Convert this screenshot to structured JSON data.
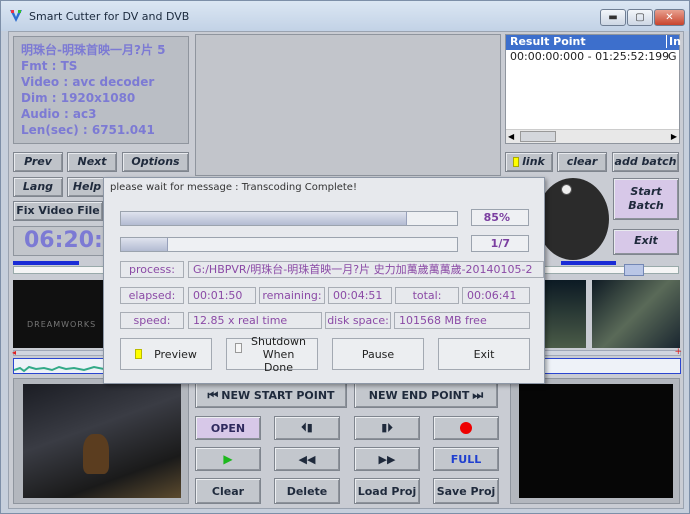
{
  "window": {
    "title": "Smart Cutter for DV and DVB",
    "min_label": "▬",
    "max_label": "▢",
    "close_label": "✕"
  },
  "info": {
    "line1": "明珠台-明珠首映一月?片 5",
    "fmt": "Fmt : TS",
    "video": "Video : avc decoder",
    "dim": "Dim : 1920x1080",
    "audio": "Audio : ac3",
    "len": "Len(sec) : 6751.041"
  },
  "nav": {
    "prev": "Prev",
    "next": "Next",
    "options": "Options",
    "lang": "Lang",
    "help": "Help",
    "fix_video": "Fix Video File"
  },
  "timecode": "06:20:3",
  "result": {
    "col1": "Result Point",
    "col2": "In",
    "row1_col1": "00:00:00:000 - 01:25:52:199",
    "row1_col2": "G"
  },
  "batch": {
    "link": "link",
    "clear": "clear",
    "add_batch": "add batch",
    "start_batch": "Start Batch",
    "exit": "Exit"
  },
  "controls": {
    "new_start": "NEW START POINT",
    "new_end": "NEW END POINT",
    "open": "OPEN",
    "full": "FULL",
    "clear": "Clear",
    "delete": "Delete",
    "load_proj": "Load Proj",
    "save_proj": "Save Proj"
  },
  "dialog": {
    "title": "please wait for message : Transcoding Complete!",
    "progress1_label": "85%",
    "progress1_value": 0.85,
    "progress2_label": "1/7",
    "progress2_value": 0.14,
    "process_label": "process:",
    "process_value": "G:/HBPVR/明珠台-明珠首映一月?片 史力加萬歲萬萬歲-20140105-2",
    "elapsed_label": "elapsed:",
    "elapsed_value": "00:01:50",
    "remaining_label": "remaining:",
    "remaining_value": "00:04:51",
    "total_label": "total:",
    "total_value": "00:06:41",
    "speed_label": "speed:",
    "speed_value": "12.85 x real time",
    "disk_label": "disk space:",
    "disk_value": "101568 MB free",
    "preview": "Preview",
    "shutdown": "Shutdown When Done",
    "pause": "Pause",
    "exit": "Exit"
  }
}
